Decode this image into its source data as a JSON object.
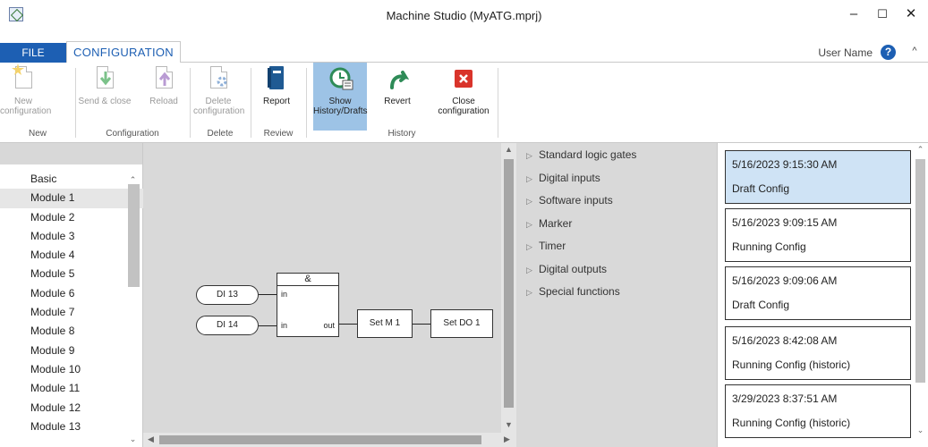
{
  "window": {
    "title": "Machine Studio (MyATG.mprj)",
    "minimize": "–",
    "maximize": "☐",
    "close": "✕"
  },
  "tabs": {
    "file": "FILE",
    "configuration": "CONFIGURATION"
  },
  "user": {
    "name": "User Name",
    "help": "?",
    "collapse": "^"
  },
  "ribbon": {
    "buttons": [
      {
        "label": "New configuration",
        "icon": "new-config-icon",
        "enabled": false
      },
      {
        "label": "Send & close",
        "icon": "send-close-icon",
        "enabled": false
      },
      {
        "label": "Reload",
        "icon": "reload-icon",
        "enabled": false
      },
      {
        "label": "Delete configuration",
        "icon": "delete-config-icon",
        "enabled": false
      },
      {
        "label": "Report",
        "icon": "report-icon",
        "enabled": true
      },
      {
        "label": "Show History/Drafts",
        "icon": "history-icon",
        "enabled": true,
        "active": true
      },
      {
        "label": "Revert",
        "icon": "revert-icon",
        "enabled": true
      },
      {
        "label": "Close configuration",
        "icon": "close-config-icon",
        "enabled": true
      }
    ],
    "groups": [
      "New",
      "Configuration",
      "Delete",
      "Review",
      "History"
    ]
  },
  "module_list": {
    "items": [
      "Basic",
      "Module 1",
      "Module 2",
      "Module 3",
      "Module 4",
      "Module 5",
      "Module 6",
      "Module 7",
      "Module 8",
      "Module 9",
      "Module 10",
      "Module 11",
      "Module 12",
      "Module 13"
    ],
    "selected": "Module 1"
  },
  "diagram": {
    "inputs": [
      "DI 13",
      "DI 14"
    ],
    "gate": {
      "symbol": "&",
      "in1": "in",
      "in2": "in",
      "out": "out"
    },
    "marker": "Set M 1",
    "output": "Set DO 1"
  },
  "toolbox": {
    "items": [
      "Standard logic gates",
      "Digital inputs",
      "Software inputs",
      "Marker",
      "Timer",
      "Digital outputs",
      "Special functions"
    ]
  },
  "history": {
    "items": [
      {
        "time": "5/16/2023 9:15:30 AM",
        "label": "Draft Config",
        "selected": true
      },
      {
        "time": "5/16/2023 9:09:15 AM",
        "label": "Running Config",
        "selected": false
      },
      {
        "time": "5/16/2023 9:09:06 AM",
        "label": "Draft Config",
        "selected": false
      },
      {
        "time": "5/16/2023 8:42:08 AM",
        "label": "Running Config (historic)",
        "selected": false
      },
      {
        "time": "3/29/2023 8:37:51 AM",
        "label": "Running Config (historic)",
        "selected": false
      }
    ]
  },
  "colors": {
    "accent": "#1d5fb3",
    "active_button": "#9dc3e6",
    "selected_history": "#cfe3f5",
    "close_red": "#d9342b",
    "green": "#2e8b57"
  }
}
